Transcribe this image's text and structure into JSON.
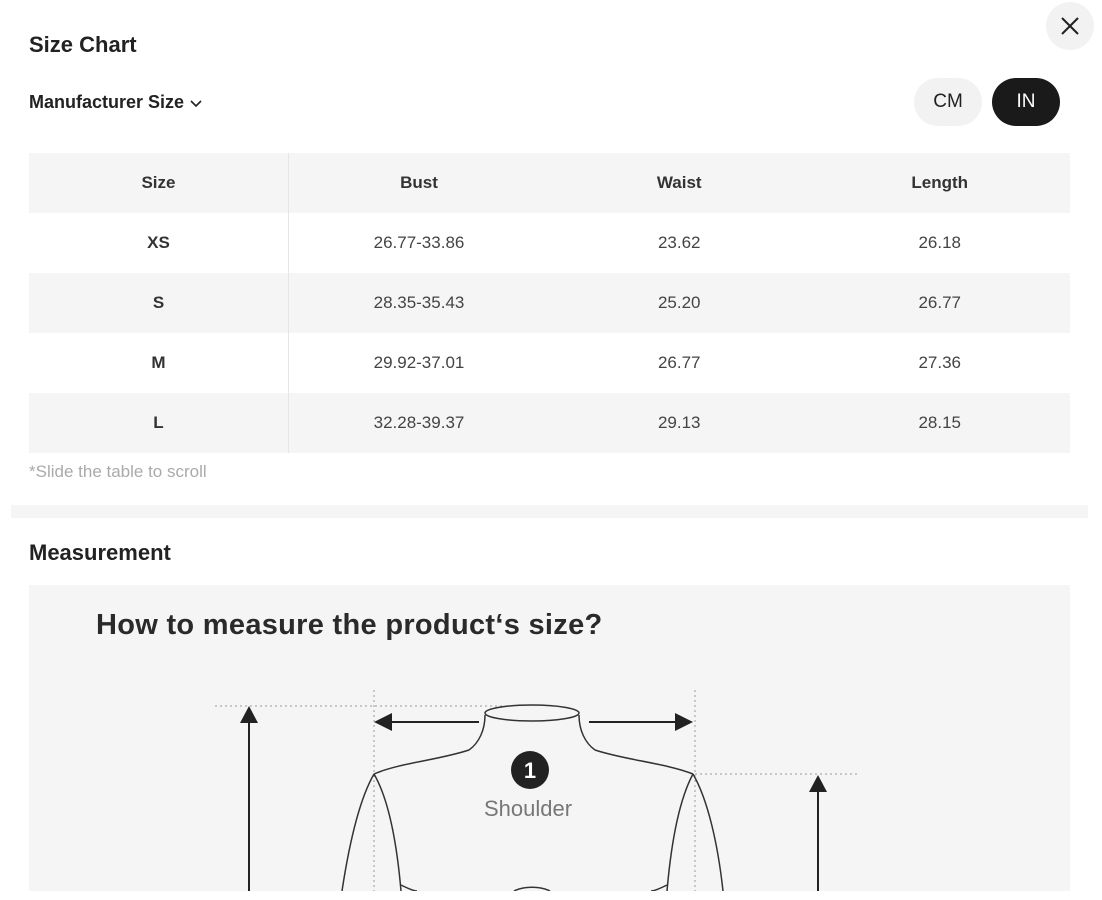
{
  "header": {
    "title": "Size Chart",
    "manufacturer_label": "Manufacturer Size"
  },
  "units": {
    "cm_label": "CM",
    "in_label": "IN",
    "selected": "IN"
  },
  "table": {
    "columns": [
      "Size",
      "Bust",
      "Waist",
      "Length"
    ],
    "rows": [
      [
        "XS",
        "26.77-33.86",
        "23.62",
        "26.18"
      ],
      [
        "S",
        "28.35-35.43",
        "25.20",
        "26.77"
      ],
      [
        "M",
        "29.92-37.01",
        "26.77",
        "27.36"
      ],
      [
        "L",
        "32.28-39.37",
        "29.13",
        "28.15"
      ]
    ]
  },
  "scroll_hint": "*Slide the table to scroll",
  "measurement": {
    "title": "Measurement",
    "image_heading": "How to measure the product‘s size?",
    "marker_number": "1",
    "marker_label": "Shoulder"
  },
  "colors": {
    "dark_button": "#1a1a1a",
    "light_button": "#f2f2f2",
    "row_shade": "#f5f5f5"
  }
}
